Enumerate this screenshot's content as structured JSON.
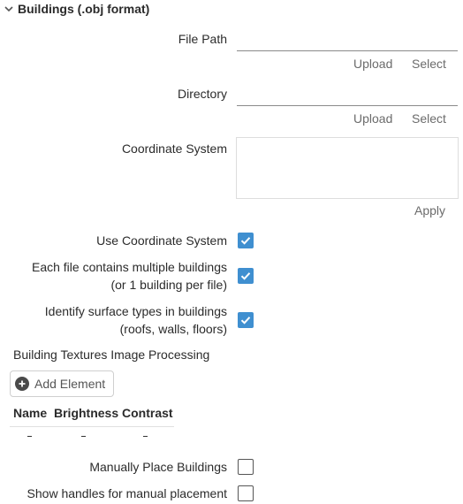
{
  "section": {
    "title": "Buildings (.obj format)",
    "icon": "chevron-down-icon"
  },
  "file_path": {
    "label": "File Path",
    "value": "",
    "upload": "Upload",
    "select": "Select"
  },
  "directory": {
    "label": "Directory",
    "value": "",
    "upload": "Upload",
    "select": "Select"
  },
  "coordinate_system": {
    "label": "Coordinate System",
    "value": "",
    "apply": "Apply"
  },
  "use_coordinate_system": {
    "label": "Use Coordinate System",
    "checked": true
  },
  "multiple_buildings": {
    "label_line1": "Each file contains multiple buildings",
    "label_line2": "(or 1 building per file)",
    "checked": true
  },
  "identify_surfaces": {
    "label_line1": "Identify surface types in buildings",
    "label_line2": "(roofs, walls, floors)",
    "checked": true
  },
  "textures": {
    "title": "Building Textures Image Processing",
    "add_label": "Add Element",
    "columns": [
      "Name",
      "Brightness",
      "Contrast"
    ]
  },
  "manual_place": {
    "label": "Manually Place Buildings",
    "checked": false
  },
  "show_handles": {
    "label": "Show handles for manual placement",
    "checked": false
  },
  "colors": {
    "accent": "#3f8fd0",
    "text": "#2b2b2b",
    "muted": "#6b6b6b"
  }
}
